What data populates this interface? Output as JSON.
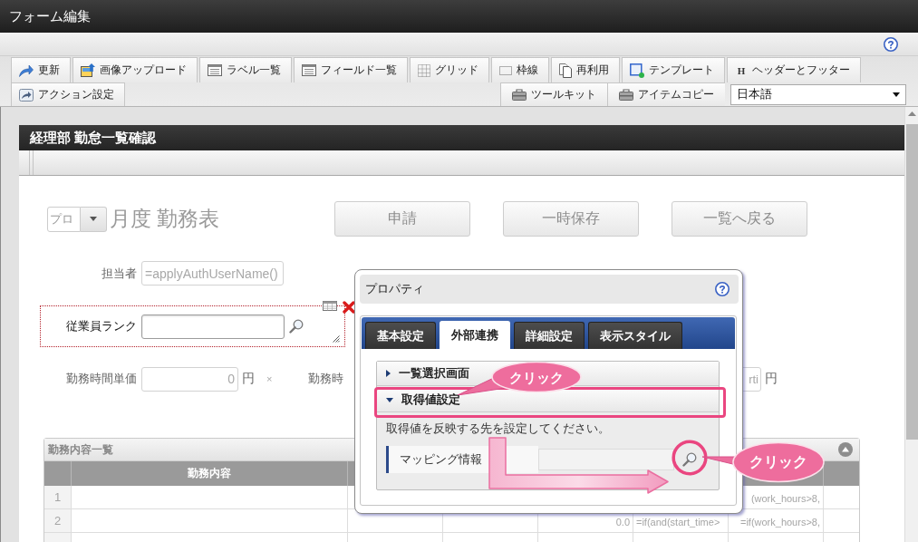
{
  "window": {
    "title": "フォーム編集"
  },
  "toolbar": {
    "main": [
      {
        "label": "更新"
      },
      {
        "label": "画像アップロード"
      },
      {
        "label": "ラベル一覧"
      },
      {
        "label": "フィールド一覧"
      },
      {
        "label": "グリッド"
      },
      {
        "label": "枠線"
      },
      {
        "label": "再利用"
      },
      {
        "label": "テンプレート"
      },
      {
        "label": "ヘッダーとフッター",
        "glyph": "H"
      }
    ],
    "secondary": [
      {
        "label": "アクション設定"
      }
    ],
    "tools": [
      {
        "label": "ツールキット"
      },
      {
        "label": "アイテムコピー"
      }
    ],
    "language_select": {
      "value": "日本語"
    }
  },
  "form": {
    "title": "経理部 勤怠一覧確認",
    "period_select": {
      "value": "プロ"
    },
    "heading": "月度 勤務表",
    "buttons": [
      "申請",
      "一時保存",
      "一覧へ戻る"
    ],
    "assignee": {
      "label": "担当者",
      "value": "=applyAuthUserName()"
    },
    "employee_rank": {
      "label": "従業員ランク",
      "selected": true
    },
    "hourly_rate": {
      "label": "勤務時間単価",
      "value": "0",
      "unit": "円",
      "clear_mark": "×"
    },
    "work_hours": {
      "label": "勤務時",
      "value": "rti",
      "unit": "円"
    },
    "table": {
      "title": "勤務内容一覧",
      "columns": [
        "勤務内容"
      ],
      "rows": [
        {
          "number": "1",
          "column_6": "(work_hours>8,"
        },
        {
          "number": "2",
          "column_4": "0.0",
          "column_5": "=if(and(start_time>",
          "column_6": "=if(work_hours>8,"
        }
      ]
    }
  },
  "properties_dialog": {
    "title": "プロパティ",
    "tabs": [
      {
        "label": "基本設定",
        "selected": false
      },
      {
        "label": "外部連携",
        "selected": true
      },
      {
        "label": "詳細設定",
        "selected": false
      },
      {
        "label": "表示スタイル",
        "selected": false
      }
    ],
    "sections": [
      {
        "label": "一覧選択画面",
        "expanded": false
      },
      {
        "label": "取得値設定",
        "expanded": true,
        "description": "取得値を反映する先を設定してください。",
        "mapping_label": "マッピング情報"
      }
    ]
  },
  "callouts": [
    {
      "text": "クリック"
    },
    {
      "text": "クリック"
    }
  ]
}
